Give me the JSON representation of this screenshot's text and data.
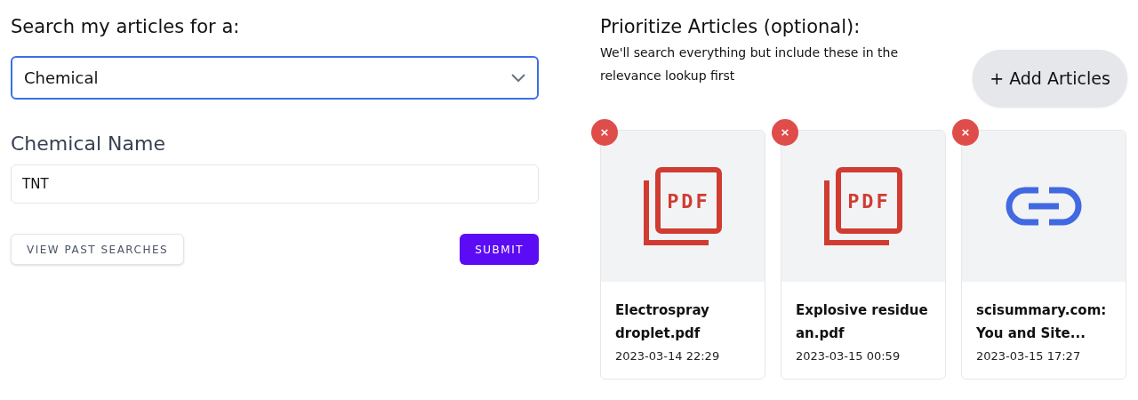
{
  "search": {
    "heading": "Search my articles for a:",
    "type_select": {
      "value": "Chemical"
    },
    "name_field": {
      "label": "Chemical Name",
      "value": "TNT"
    },
    "buttons": [
      {
        "label": "VIEW PAST SEARCHES",
        "kind": "secondary"
      },
      {
        "label": "SUBMIT",
        "kind": "primary"
      }
    ]
  },
  "prioritize": {
    "heading": "Prioritize Articles (optional):",
    "description": "We'll search everything but include these in the relevance lookup first",
    "add_button": "+ Add Articles",
    "remove_label": "×",
    "articles": [
      {
        "kind": "pdf",
        "icon_text": "PDF",
        "title": "Electrospray droplet.pdf",
        "date": "2023-03-14 22:29"
      },
      {
        "kind": "pdf",
        "icon_text": "PDF",
        "title": "Explosive residue an.pdf",
        "date": "2023-03-15 00:59"
      },
      {
        "kind": "link",
        "title": "scisummary.com: You and Site...",
        "date": "2023-03-15 17:27"
      }
    ]
  }
}
